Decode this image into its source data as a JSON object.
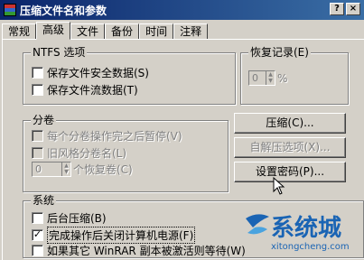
{
  "window": {
    "title": "压缩文件名和参数"
  },
  "tabs": [
    {
      "label": "常规"
    },
    {
      "label": "高级"
    },
    {
      "label": "文件"
    },
    {
      "label": "备份"
    },
    {
      "label": "时间"
    },
    {
      "label": "注释"
    }
  ],
  "ntfs": {
    "title": "NTFS 选项",
    "save_security": "保存文件安全数据(S)",
    "save_streams": "保存文件流数据(T)"
  },
  "recovery": {
    "title": "恢复记录(E)",
    "value": "0",
    "unit": "%"
  },
  "volumes": {
    "title": "分卷",
    "pause_each": "每个分卷操作完之后暂停(V)",
    "old_style": "旧风格分卷名(L)",
    "recovery_value": "0",
    "recovery_label": "个恢复卷(C)"
  },
  "buttons": {
    "compress": "压缩(C)...",
    "sfx": "自解压选项(X)...",
    "password": "设置密码(P)..."
  },
  "system": {
    "title": "系统",
    "background": "后台压缩(B)",
    "shutdown": "完成操作后关闭计算机电源(F)",
    "wait": "如果其它 WinRAR 副本被激活则等待(W)"
  },
  "watermark": {
    "brand": "系统城",
    "url": "xitongcheng.com"
  },
  "colors": {
    "titlebar": "#0a246a",
    "face": "#d4d0c8",
    "watermark": "#1a64b4"
  }
}
